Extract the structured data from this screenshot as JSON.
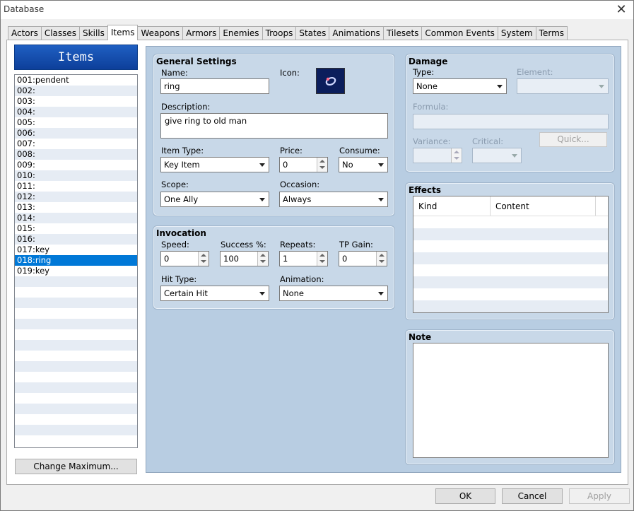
{
  "window": {
    "title": "Database"
  },
  "tabs": [
    "Actors",
    "Classes",
    "Skills",
    "Items",
    "Weapons",
    "Armors",
    "Enemies",
    "Troops",
    "States",
    "Animations",
    "Tilesets",
    "Common Events",
    "System",
    "Terms"
  ],
  "active_tab": "Items",
  "list": {
    "header": "Items",
    "items": [
      "001:pendent",
      "002:",
      "003:",
      "004:",
      "005:",
      "006:",
      "007:",
      "008:",
      "009:",
      "010:",
      "011:",
      "012:",
      "013:",
      "014:",
      "015:",
      "016:",
      "017:key",
      "018:ring",
      "019:key"
    ],
    "selected": "018:ring",
    "change_max_label": "Change Maximum..."
  },
  "general": {
    "title": "General Settings",
    "name_label": "Name:",
    "name_value": "ring",
    "icon_label": "Icon:",
    "icon_name": "ring-icon",
    "description_label": "Description:",
    "description_value": "give ring to old man",
    "item_type_label": "Item Type:",
    "item_type_value": "Key Item",
    "price_label": "Price:",
    "price_value": "0",
    "consume_label": "Consume:",
    "consume_value": "No",
    "scope_label": "Scope:",
    "scope_value": "One Ally",
    "occasion_label": "Occasion:",
    "occasion_value": "Always"
  },
  "invocation": {
    "title": "Invocation",
    "speed_label": "Speed:",
    "speed_value": "0",
    "success_label": "Success %:",
    "success_value": "100",
    "repeats_label": "Repeats:",
    "repeats_value": "1",
    "tp_gain_label": "TP Gain:",
    "tp_gain_value": "0",
    "hit_type_label": "Hit Type:",
    "hit_type_value": "Certain Hit",
    "animation_label": "Animation:",
    "animation_value": "None"
  },
  "damage": {
    "title": "Damage",
    "type_label": "Type:",
    "type_value": "None",
    "element_label": "Element:",
    "formula_label": "Formula:",
    "variance_label": "Variance:",
    "critical_label": "Critical:",
    "quick_label": "Quick..."
  },
  "effects": {
    "title": "Effects",
    "columns": [
      "Kind",
      "Content"
    ]
  },
  "note": {
    "title": "Note"
  },
  "footer": {
    "ok": "OK",
    "cancel": "Cancel",
    "apply": "Apply"
  },
  "colors": {
    "list_header": "#1f5fc2",
    "selection": "#0078d7",
    "panel": "#c8d8e8"
  }
}
